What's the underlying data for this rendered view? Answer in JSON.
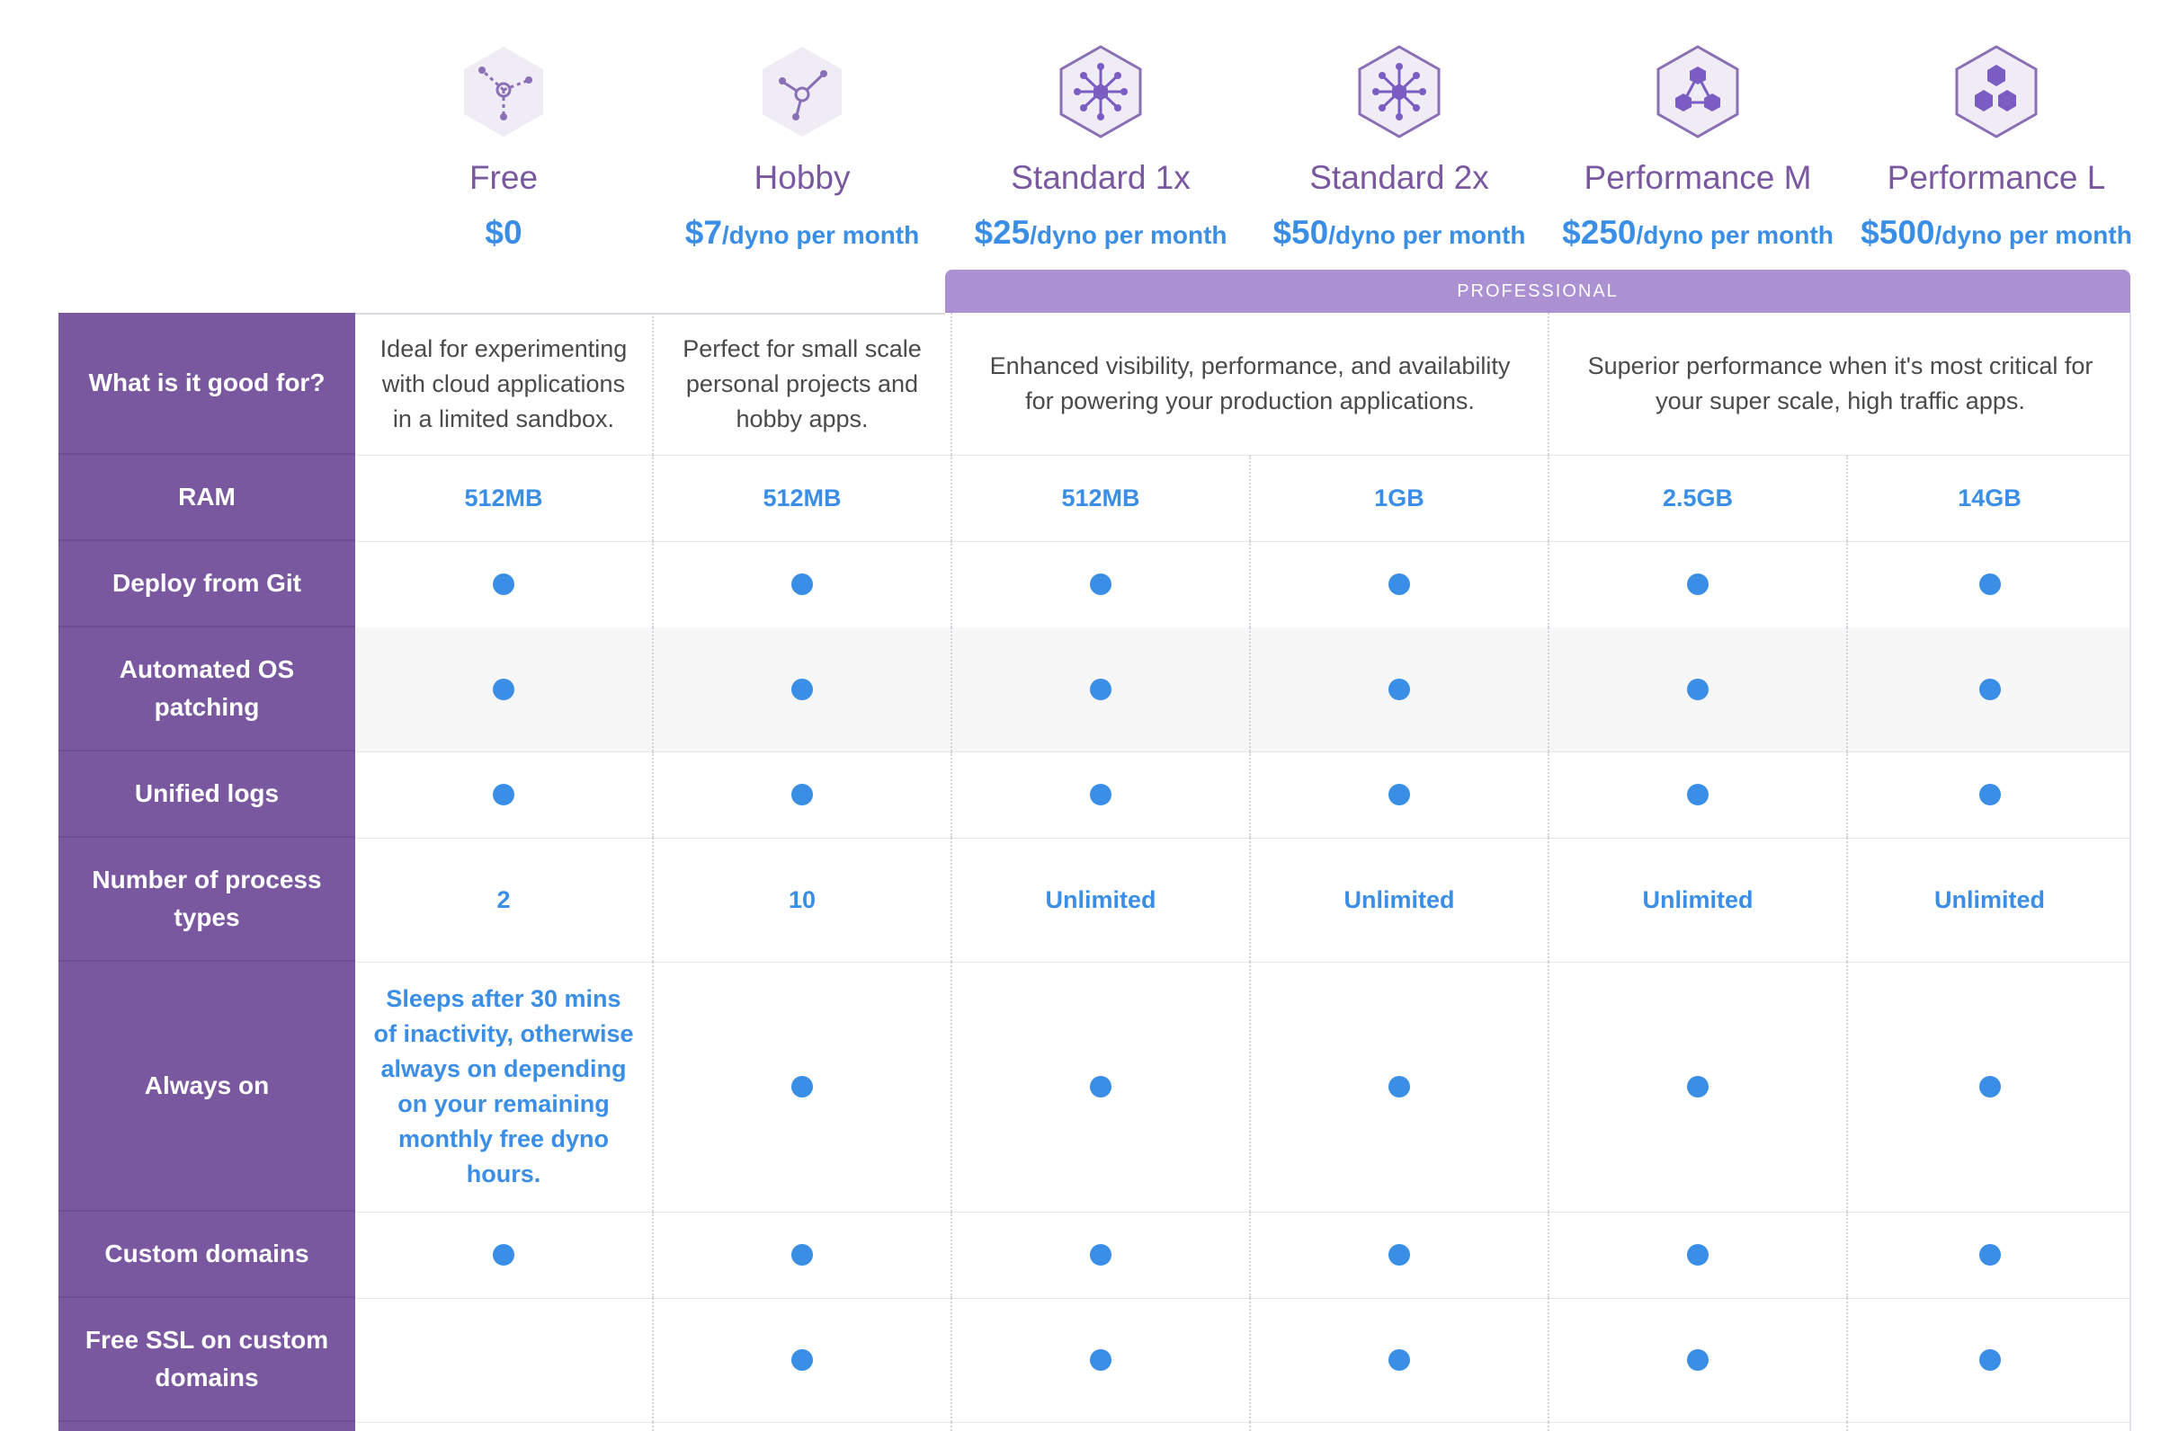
{
  "plans": [
    {
      "name": "Free",
      "price": "$0",
      "unit": "",
      "icon": "free-dyno-icon"
    },
    {
      "name": "Hobby",
      "price": "$7",
      "unit": "/dyno per month",
      "icon": "hobby-dyno-icon"
    },
    {
      "name": "Standard 1x",
      "price": "$25",
      "unit": "/dyno per month",
      "icon": "standard-1x-dyno-icon"
    },
    {
      "name": "Standard 2x",
      "price": "$50",
      "unit": "/dyno per month",
      "icon": "standard-2x-dyno-icon"
    },
    {
      "name": "Performance M",
      "price": "$250",
      "unit": "/dyno per month",
      "icon": "performance-m-dyno-icon"
    },
    {
      "name": "Performance L",
      "price": "$500",
      "unit": "/dyno per month",
      "icon": "performance-l-dyno-icon"
    }
  ],
  "professional_label": "PROFESSIONAL",
  "colors": {
    "purple": "#79589f",
    "accent": "#3a8ee6",
    "band": "#ab90d2"
  },
  "rows": [
    {
      "label": "What is it good for?",
      "cells": [
        "Ideal for experimenting with cloud applications in a limited sandbox.",
        "Perfect for small scale personal projects and hobby apps.",
        "Enhanced visibility, performance, and availability for powering your production applications.",
        "Superior performance when it's most critical for your super scale, high traffic apps."
      ]
    },
    {
      "label": "RAM",
      "cells": [
        "512MB",
        "512MB",
        "512MB",
        "1GB",
        "2.5GB",
        "14GB"
      ]
    },
    {
      "label": "Deploy from Git",
      "included": [
        true,
        true,
        true,
        true,
        true,
        true
      ]
    },
    {
      "label": "Automated OS patching",
      "included": [
        true,
        true,
        true,
        true,
        true,
        true
      ]
    },
    {
      "label": "Unified logs",
      "included": [
        true,
        true,
        true,
        true,
        true,
        true
      ]
    },
    {
      "label": "Number of process types",
      "cells": [
        "2",
        "10",
        "Unlimited",
        "Unlimited",
        "Unlimited",
        "Unlimited"
      ]
    },
    {
      "label": "Always on",
      "free_note": "Sleeps after 30 mins of inactivity, otherwise always on depending on your remaining monthly free dyno hours.",
      "included": [
        false,
        true,
        true,
        true,
        true,
        true
      ]
    },
    {
      "label": "Custom domains",
      "included": [
        true,
        true,
        true,
        true,
        true,
        true
      ]
    },
    {
      "label": "Free SSL on custom domains",
      "included": [
        false,
        true,
        true,
        true,
        true,
        true
      ]
    }
  ]
}
